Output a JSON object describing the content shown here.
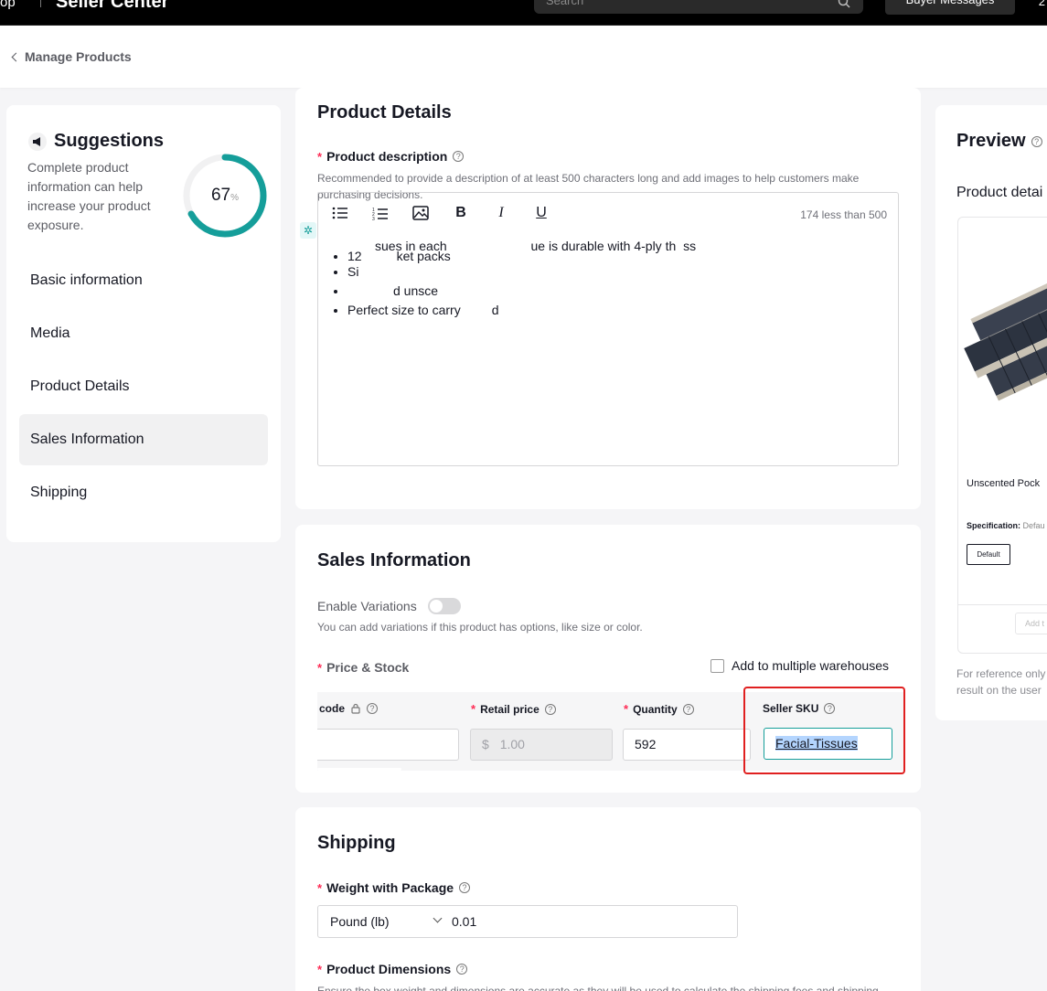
{
  "topbar": {
    "brand_fragment": "op",
    "title": "Seller Center",
    "search_placeholder": "Search",
    "buyer_messages": "Buyer Messages",
    "edge_text": "2"
  },
  "breadcrumb": {
    "back_label": "Manage Products"
  },
  "suggestions": {
    "title": "Suggestions",
    "description": "Complete product information can help increase your product exposure.",
    "progress": 67,
    "progress_unit": "%",
    "accent_color": "#159e9a",
    "nav": [
      {
        "label": "Basic information"
      },
      {
        "label": "Media"
      },
      {
        "label": "Product Details"
      },
      {
        "label": "Sales Information"
      },
      {
        "label": "Shipping"
      }
    ]
  },
  "product_details": {
    "title": "Product Details",
    "description_label": "Product description",
    "description_help": "Recommended to provide a description of at least 500 characters long and add images to help customers make purchasing decisions.",
    "char_count": "174 less than 500",
    "content_line1": "sues in each",
    "content_line1b": "ue is durable with 4-ply th",
    "content_line1c": "ss",
    "bullets": [
      "12",
      "ket packs",
      "Si",
      "d unsce",
      "Perfect size to carry",
      "d"
    ]
  },
  "sales": {
    "title": "Sales Information",
    "variations_label": "Enable Variations",
    "variations_help": "You can add variations if this product has options, like size or color.",
    "price_stock_label": "Price & Stock",
    "warehouses_label": "Add to multiple warehouses",
    "columns": {
      "code": "code",
      "retail_price": "Retail price",
      "quantity": "Quantity",
      "seller_sku": "Seller SKU"
    },
    "currency": "$",
    "retail_price_value": "1.00",
    "quantity_value": "592",
    "seller_sku_value": "Facial-Tissues"
  },
  "shipping": {
    "title": "Shipping",
    "weight_label": "Weight with Package",
    "weight_unit": "Pound (lb)",
    "weight_value": "0.01",
    "dimensions_label": "Product Dimensions",
    "dimensions_help": "Ensure the box weight and dimensions are accurate as they will be used to calculate the shipping fees and shipping"
  },
  "preview": {
    "title": "Preview",
    "subtitle": "Product detai",
    "unscented": "Unscented Pock",
    "spec_label": "Specification:",
    "spec_value": "Defau",
    "default_btn": "Default",
    "add_btn": "Add t",
    "note_line1": "For reference only",
    "note_line2": "result on the user"
  }
}
